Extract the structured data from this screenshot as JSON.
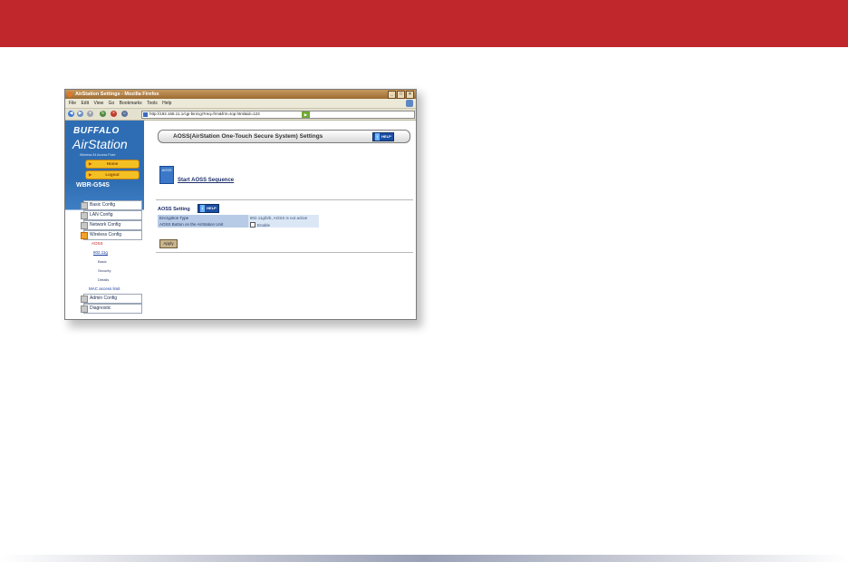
{
  "colors": {
    "banner": "#c0272d",
    "sidebar_blue": "#2e6db4",
    "pill_yellow": "#f3c024"
  },
  "browser": {
    "title": "AirStation Settings - Mozilla Firefox",
    "menu": [
      "File",
      "Edit",
      "View",
      "Go",
      "Bookmarks",
      "Tools",
      "Help"
    ],
    "url": "http://192.168.11.1/cgi-bin/cgi?req=frm&frm=top.html&id=123",
    "window_buttons": [
      "_",
      "□",
      "×"
    ]
  },
  "sidebar": {
    "brand": "BUFFALO",
    "product": "AirStation",
    "subtitle": "Wireless 54 Access Point",
    "pills": [
      "Home",
      "Logout"
    ],
    "model": "WBR-G54S",
    "menu": [
      "Basic Config",
      "LAN Config",
      "Network Config",
      "Wireless Config"
    ],
    "wireless_sub": {
      "aoss": "AOSS",
      "wep": "802.11g",
      "basic": "Basic",
      "security": "Security",
      "details": "Details",
      "mac": "MAC access limit"
    },
    "menu_bottom": [
      "Admin Config",
      "Diagnostic"
    ]
  },
  "main": {
    "header_title": "AOSS(AirStation One-Touch Secure System) Settings",
    "help_label": "HELP",
    "aoss_icon_text": "AOSS",
    "start_link": "Start AOSS Sequence",
    "setting_label": "AOSS Setting",
    "rows": [
      {
        "key": "Encryption Type",
        "value": "802.11g/b/b, AOSS is not active"
      },
      {
        "key": "AOSS Button on the AirStation Unit",
        "value": "Enable"
      }
    ],
    "apply_label": "Apply"
  }
}
